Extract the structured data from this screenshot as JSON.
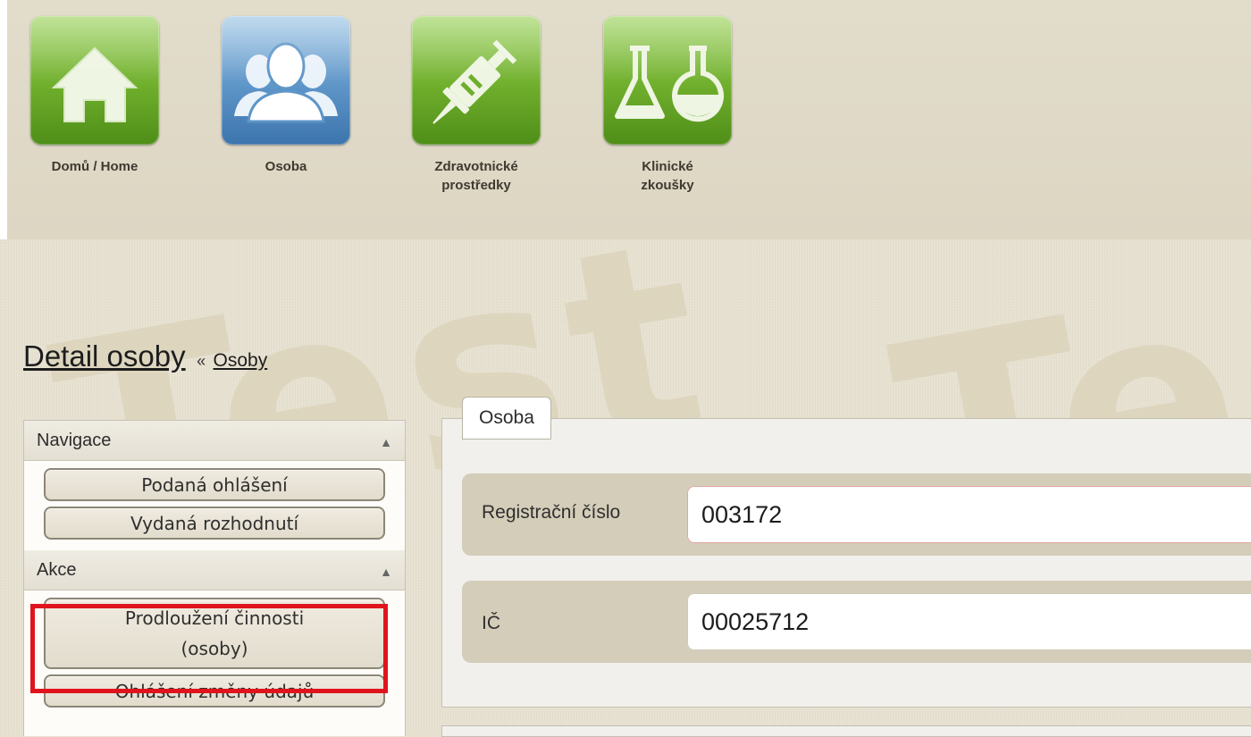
{
  "nav": {
    "tiles": [
      {
        "label_line1": "Domů / Home",
        "label_line2": "",
        "icon": "home-icon",
        "color": "#6fae2c"
      },
      {
        "label_line1": "Osoba",
        "label_line2": "",
        "icon": "people-icon",
        "color": "#5e95c8"
      },
      {
        "label_line1": "Zdravotnické",
        "label_line2": "prostředky",
        "icon": "syringe-icon",
        "color": "#6fae2c"
      },
      {
        "label_line1": "Klinické",
        "label_line2": "zkoušky",
        "icon": "flask-icon",
        "color": "#6fae2c"
      }
    ]
  },
  "watermark": {
    "text": "Test"
  },
  "heading": {
    "title": "Detail osoby",
    "separator": "«",
    "breadcrumb": "Osoby"
  },
  "sidebar": {
    "sections": [
      {
        "title": "Navigace",
        "items": [
          "Podaná ohlášení",
          "Vydaná rozhodnutí"
        ]
      },
      {
        "title": "Akce",
        "items": [
          "Prodloužení činnosti",
          "(osoby)",
          "Ohlášení změny údajů"
        ]
      }
    ],
    "collapse_arrow": "▲"
  },
  "main": {
    "tab_label": "Osoba",
    "fields": [
      {
        "label": "Registrační číslo",
        "value": "003172"
      },
      {
        "label": "IČ",
        "value": "00025712"
      }
    ]
  },
  "colors": {
    "highlight": "#e0141d",
    "tile_green": "#6fae2c",
    "tile_blue": "#5e95c8"
  }
}
